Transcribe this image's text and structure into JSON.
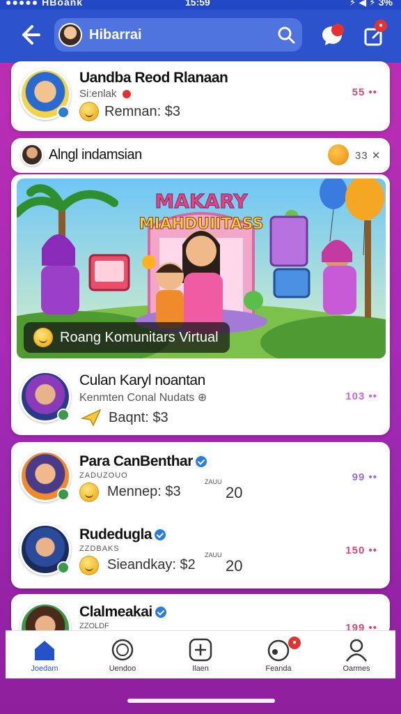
{
  "status_bar": {
    "left": "●●●●● HBoank",
    "time": "15:59",
    "right": "⚡ ◀ ⚡ 3%"
  },
  "header": {
    "search_text": "Hibarrai"
  },
  "cards": [
    {
      "name": "Uandba Reod Rlanaan",
      "sub": "Si:enlak",
      "price": "Remnan: $3",
      "trail": "55 ••"
    },
    {
      "name": "Alngl indamsian",
      "trail": "33 ✕"
    },
    {
      "banner_label": "Roang Komunitars Virtual",
      "banner_title": "MAKARY MIAHDUIITASS"
    },
    {
      "name": "Culan Karyl noantan",
      "sub": "Kenmten Conal Nudats ⊕",
      "price": "Baqnt: $3",
      "trail": "103 ••"
    },
    {
      "name": "Para CanBenthar",
      "sub": "ZADUZOUO",
      "price": "Mennep: $3",
      "small": "ZAUU",
      "count": "20",
      "trail": "99 ••"
    },
    {
      "name": "Rudedugla",
      "sub": "ZZDBAKS",
      "price": "Sieandkay: $2",
      "small": "ZAUU",
      "count": "20",
      "trail": "150 ••"
    },
    {
      "name": "Clalmeakai",
      "sub": "ZZOLDF",
      "trail": "199 ••"
    }
  ],
  "nav": [
    {
      "label": "Joedam",
      "icon": "home-icon"
    },
    {
      "label": "Uendoo",
      "icon": "coin-icon"
    },
    {
      "label": "Ilaen",
      "icon": "add-icon"
    },
    {
      "label": "Feanda",
      "icon": "notifications-icon"
    },
    {
      "label": "Oarmes",
      "icon": "profile-icon"
    }
  ],
  "colors": {
    "brand_blue": "#2c52cc",
    "background": "#b02bb3",
    "accent_red": "#e33232",
    "trail_pink": "#d44a7a",
    "trail_violet": "#9b6fd6"
  }
}
